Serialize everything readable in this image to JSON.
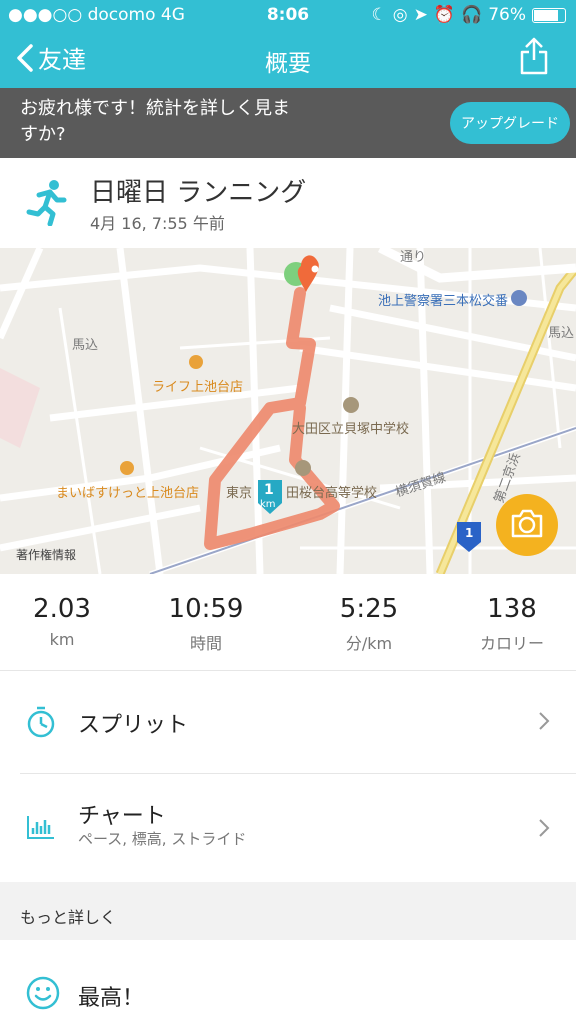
{
  "status": {
    "carrier": "●●●○○ docomo  4G",
    "time": "8:06",
    "battery": "76%"
  },
  "nav": {
    "back_label": "友達",
    "title": "概要"
  },
  "banner": {
    "message": "お疲れ様です！統計を詳しく見ますか?",
    "upgrade_label": "アップグレード"
  },
  "activity": {
    "title": "日曜日 ランニング",
    "date": "4月 16, 7:55 午前"
  },
  "map": {
    "labels": {
      "road_top": "通り",
      "police": "池上警察署三本松交番",
      "umagome_left": "馬込",
      "umagome_right": "馬込",
      "life": "ライフ上池台店",
      "school1": "大田区立貝塚中学校",
      "school2": "東京",
      "school2b": "田桜台高等学校",
      "yokosuka": "横須賀線",
      "maibasu": "まいばすけっと上池台店",
      "expressway": "第二京浜",
      "km_marker": "1",
      "km_unit": "km",
      "route_num": "1",
      "credit": "著作権情報"
    }
  },
  "stats": [
    {
      "value": "2.03",
      "unit": "km"
    },
    {
      "value": "10:59",
      "unit": "時間"
    },
    {
      "value": "5:25",
      "unit": "分/km"
    },
    {
      "value": "138",
      "unit": "カロリー"
    }
  ],
  "rows": {
    "splits": {
      "label": "スプリット"
    },
    "charts": {
      "label": "チャート",
      "sub": "ペース, 標高, ストライド"
    }
  },
  "more": {
    "title": "もっと詳しく"
  },
  "feeling": {
    "label": "最高！"
  },
  "colors": {
    "accent": "#33bfd3",
    "route": "#ee8a6e",
    "banner": "#5a5a5a",
    "pin": "#f06a3a"
  }
}
